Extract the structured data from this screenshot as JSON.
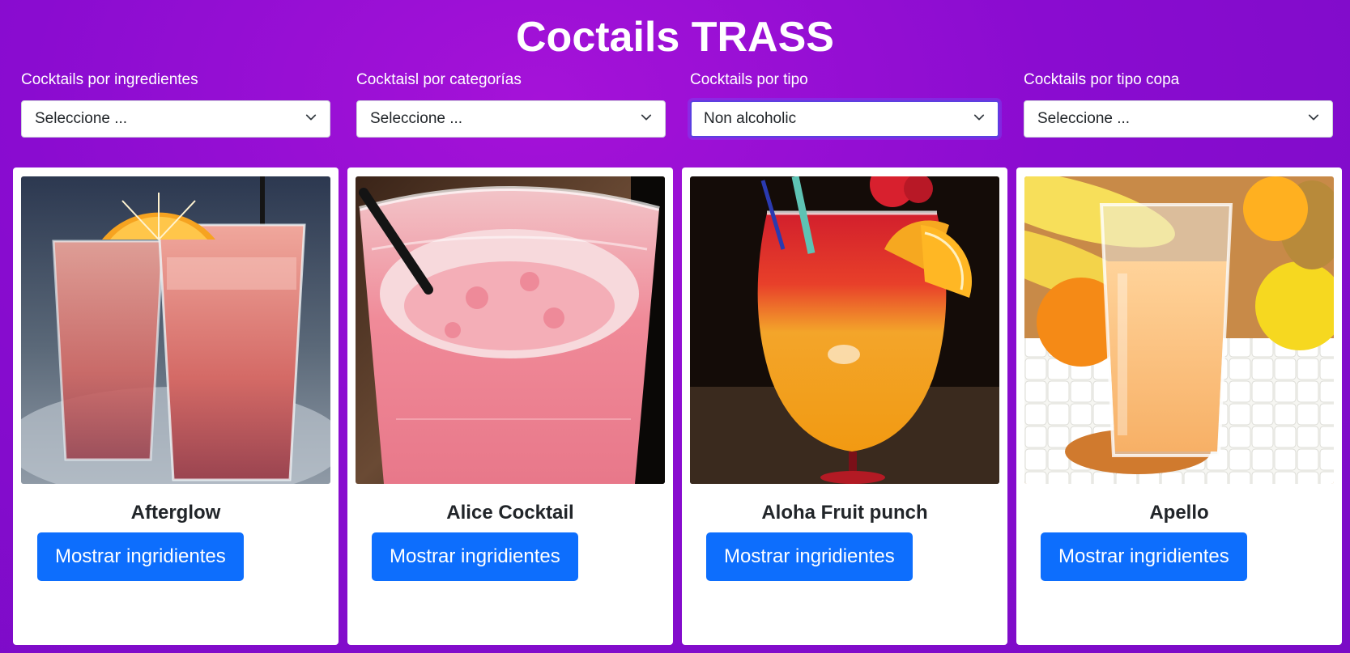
{
  "page": {
    "title": "Coctails TRASS"
  },
  "filters": [
    {
      "label": "Cocktails por ingredientes",
      "value": "Seleccione ...",
      "focused": false
    },
    {
      "label": "Cocktaisl por categorías",
      "value": "Seleccione ...",
      "focused": false
    },
    {
      "label": "Cocktails por tipo",
      "value": "Non alcoholic",
      "focused": true
    },
    {
      "label": "Cocktails por tipo copa",
      "value": "Seleccione ...",
      "focused": false
    }
  ],
  "cards": [
    {
      "name": "Afterglow",
      "button": "Mostrar ingridientes",
      "image": "two-glasses-pink-drink-with-orange-icon"
    },
    {
      "name": "Alice Cocktail",
      "button": "Mostrar ingridientes",
      "image": "pink-frothy-drink-with-straw-icon"
    },
    {
      "name": "Aloha Fruit punch",
      "button": "Mostrar ingridientes",
      "image": "layered-punch-with-orange-slice-icon"
    },
    {
      "name": "Apello",
      "button": "Mostrar ingridientes",
      "image": "orange-juice-glass-with-fruits-icon"
    }
  ],
  "colors": {
    "background": "#8a0cd0",
    "button": "#0d6efd",
    "focus_ring": "#5b3fe0"
  }
}
